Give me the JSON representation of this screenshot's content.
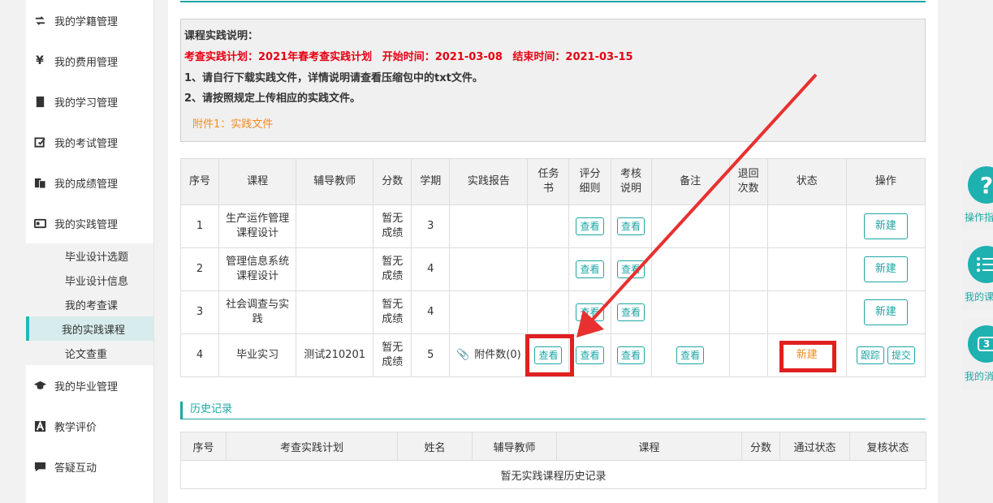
{
  "sidebar": {
    "items": [
      {
        "label": "我的学籍管理",
        "icon": "refresh-icon"
      },
      {
        "label": "我的费用管理",
        "icon": "yen-icon"
      },
      {
        "label": "我的学习管理",
        "icon": "book-icon"
      },
      {
        "label": "我的考试管理",
        "icon": "edit-icon"
      },
      {
        "label": "我的成绩管理",
        "icon": "document-icon"
      },
      {
        "label": "我的实践管理",
        "icon": "id-card-icon"
      }
    ],
    "subitems": [
      "毕业设计选题",
      "毕业设计信息",
      "我的考查课",
      "我的实践课程",
      "论文查重"
    ],
    "active_sub": "我的实践课程",
    "items_after": [
      {
        "label": "我的毕业管理",
        "icon": "graduation-cap-icon"
      },
      {
        "label": "教学评价",
        "icon": "letter-a-icon"
      },
      {
        "label": "答疑互动",
        "icon": "chat-icon"
      }
    ]
  },
  "notice": {
    "title": "课程实践说明：",
    "plan_label": "考查实践计划：2021年春考查实践计划",
    "start_label": "开始时间：2021-03-08",
    "end_label": "结束时间：2021-03-15",
    "line1": "1、请自行下载实践文件，详情说明请查看压缩包中的txt文件。",
    "line2": "2、请按照规定上传相应的实践文件。",
    "attachment": "附件1：实践文件"
  },
  "main_table": {
    "headers": {
      "no": "序号",
      "course": "课程",
      "tutor": "辅导教师",
      "score": "分数",
      "term": "学期",
      "report": "实践报告",
      "task_a": "任务",
      "task_b": "书",
      "rubric_a": "评分",
      "rubric_b": "细则",
      "assess_a": "考核",
      "assess_b": "说明",
      "remark": "备注",
      "return_a": "退回",
      "return_b": "次数",
      "status": "状态",
      "ops": "操作"
    },
    "rows": [
      {
        "no": "1",
        "course": "生产运作管理课程设计",
        "tutor": "",
        "score": "暂无成绩",
        "term": "3",
        "report": "",
        "rubric": "查看",
        "assess": "查看",
        "op_new": "新建"
      },
      {
        "no": "2",
        "course": "管理信息系统课程设计",
        "tutor": "",
        "score": "暂无成绩",
        "term": "4",
        "report": "",
        "rubric": "查看",
        "assess": "查看",
        "op_new": "新建"
      },
      {
        "no": "3",
        "course": "社会调查与实践",
        "tutor": "",
        "score": "暂无成绩",
        "term": "4",
        "report": "",
        "rubric": "查看",
        "assess": "查看",
        "op_new": "新建"
      },
      {
        "no": "4",
        "course": "毕业实习",
        "tutor": "测试210201",
        "score": "暂无成绩",
        "term": "5",
        "report": "附件数(0)",
        "task": "查看",
        "rubric": "查看",
        "assess": "查看",
        "remark": "查看",
        "status": "新建",
        "op_track": "跟踪",
        "op_submit": "提交"
      }
    ]
  },
  "history": {
    "title": "历史记录",
    "headers": [
      "序号",
      "考查实践计划",
      "姓名",
      "辅导教师",
      "课程",
      "分数",
      "通过状态",
      "复核状态"
    ],
    "empty": "暂无实践课程历史记录"
  },
  "float": {
    "help_label": "操作指",
    "courses_label": "我的课",
    "messages_label": "我的消",
    "messages_badge": "3"
  },
  "colors": {
    "accent": "#1fa5a5",
    "highlight": "#e02020",
    "plan_red": "#e60012",
    "orange": "#f08c21"
  }
}
